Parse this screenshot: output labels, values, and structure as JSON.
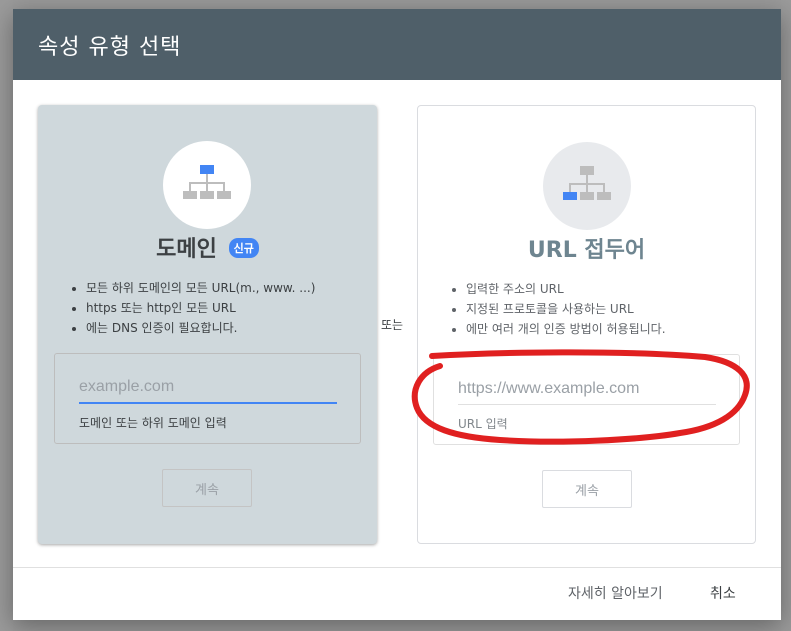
{
  "dialog": {
    "title": "속성 유형 선택"
  },
  "domain_card": {
    "title": "도메인",
    "badge": "신규",
    "bullets": [
      "모든 하위 도메인의 모든 URL(m., www. ...)",
      "https 또는 http인 모든 URL",
      "에는 DNS 인증이 필요합니다."
    ],
    "input_placeholder": "example.com",
    "input_helper": "도메인 또는 하위 도메인 입력",
    "continue_label": "계속"
  },
  "separator": {
    "label": "또는"
  },
  "url_card": {
    "title": "URL 접두어",
    "bullets": [
      "입력한 주소의 URL",
      "지정된 프로토콜을 사용하는 URL",
      "에만 여러 개의 인증 방법이 허용됩니다."
    ],
    "input_placeholder": "https://www.example.com",
    "input_helper": "URL 입력",
    "continue_label": "계속"
  },
  "footer": {
    "learn_more_label": "자세히 알아보기",
    "cancel_label": "취소"
  },
  "colors": {
    "header_bg": "#4f5f69",
    "domain_card_bg": "#cfd8dc",
    "accent_blue": "#4285f4",
    "annotation_red": "#e02020"
  },
  "icons": {
    "domain_icon": "sitemap-icon",
    "url_icon": "sitemap-icon"
  }
}
